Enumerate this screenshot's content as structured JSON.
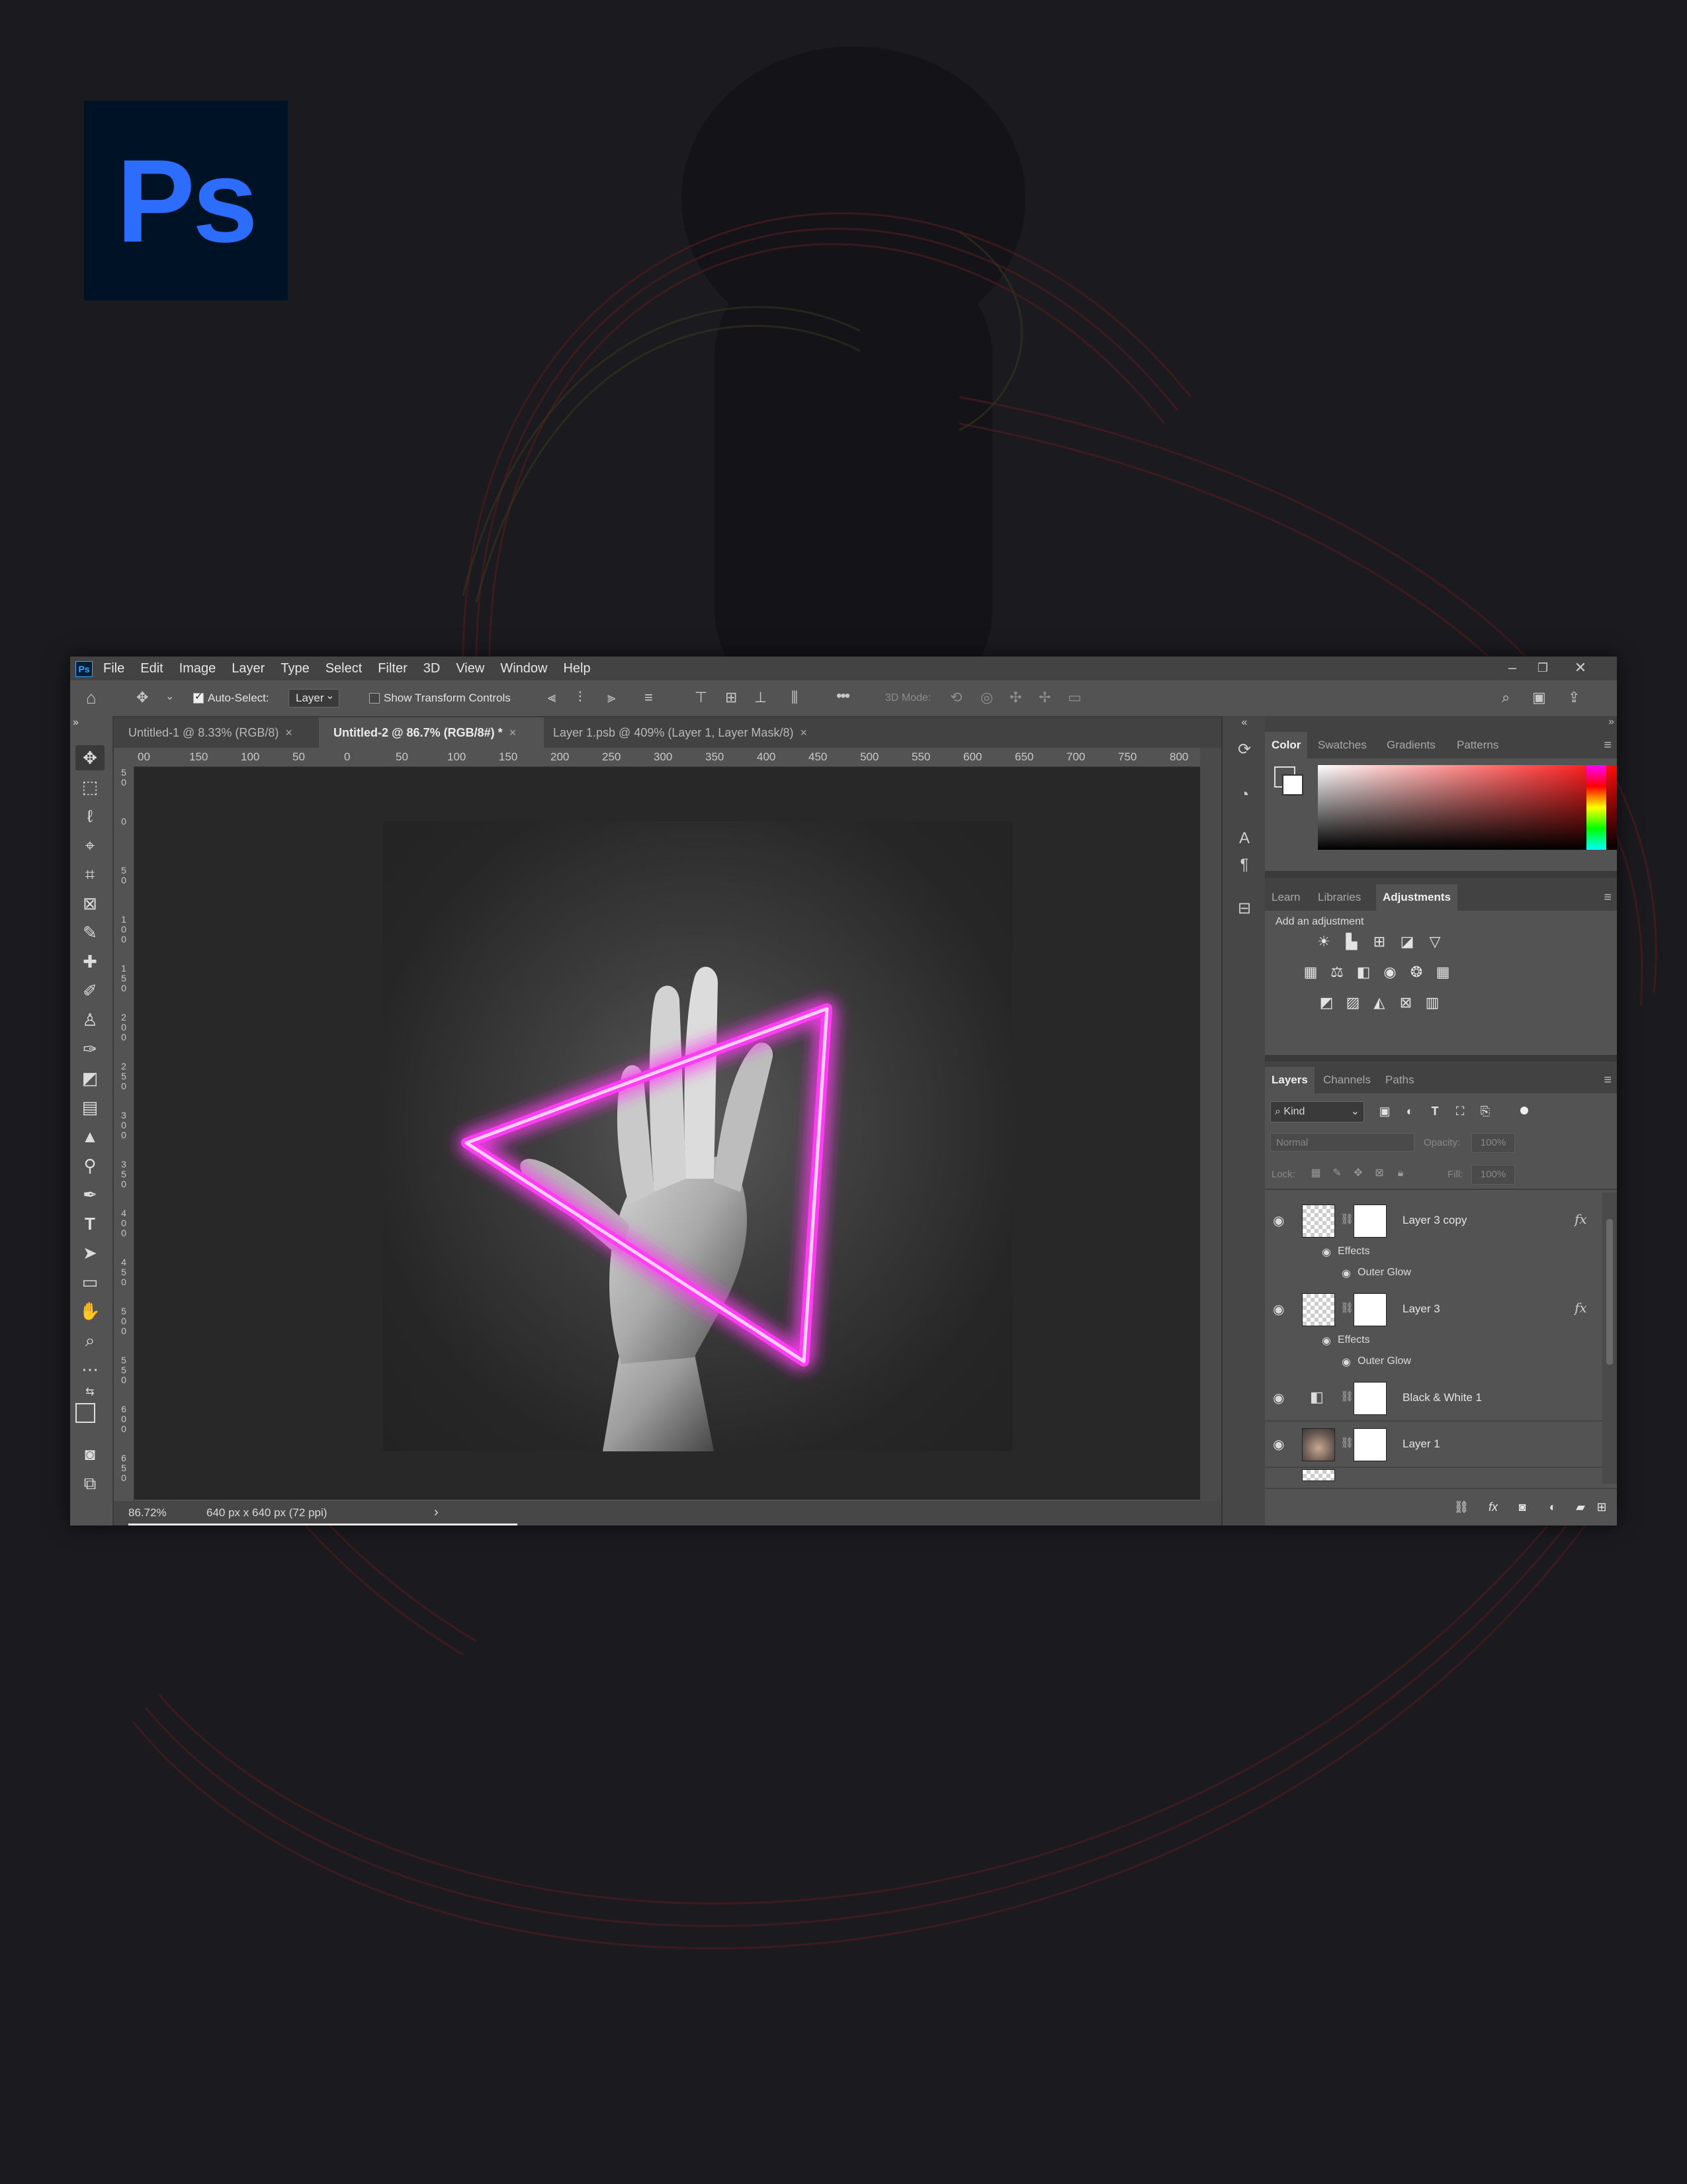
{
  "logo": {
    "text": "Ps"
  },
  "window": {
    "app_icon": "Ps",
    "menu": [
      "File",
      "Edit",
      "Image",
      "Layer",
      "Type",
      "Select",
      "Filter",
      "3D",
      "View",
      "Window",
      "Help"
    ],
    "controls": {
      "minimize": "–",
      "restore": "❐",
      "close": "✕"
    }
  },
  "options_bar": {
    "auto_select_label": "Auto-Select:",
    "auto_select_checked": true,
    "target_dropdown": "Layer",
    "show_transform_label": "Show Transform Controls",
    "show_transform_checked": false,
    "three_d_mode_label": "3D Mode:",
    "more": "•••"
  },
  "doc_tabs": [
    {
      "label": "Untitled-1 @ 8.33% (RGB/8)",
      "active": false
    },
    {
      "label": "Untitled-2 @ 86.7% (RGB/8#) *",
      "active": true
    },
    {
      "label": "Layer 1.psb @ 409% (Layer 1, Layer Mask/8)",
      "active": false
    }
  ],
  "close_glyph": "×",
  "ruler_top": [
    "00",
    "150",
    "100",
    "50",
    "0",
    "50",
    "100",
    "150",
    "200",
    "250",
    "300",
    "350",
    "400",
    "450",
    "500",
    "550",
    "600",
    "650",
    "700",
    "750",
    "800"
  ],
  "ruler_left": [
    "5 0",
    "0",
    "5 0",
    "1 0 0",
    "1 5 0",
    "2 0 0",
    "2 5 0",
    "3 0 0",
    "3 5 0",
    "4 0 0",
    "4 5 0",
    "5 0 0",
    "5 5 0",
    "6 0 0",
    "6 5 0"
  ],
  "status": {
    "zoom": "86.72%",
    "doc_info": "640 px x 640 px (72 ppi)",
    "arrow": "›"
  },
  "color_panel": {
    "tabs": [
      "Color",
      "Swatches",
      "Gradients",
      "Patterns"
    ],
    "active_tab": "Color",
    "hue_color": "#ff0000"
  },
  "adjustments_panel": {
    "tabs": [
      "Learn",
      "Libraries",
      "Adjustments"
    ],
    "active_tab": "Adjustments",
    "hint": "Add an adjustment",
    "icons_row1": [
      "brightness-icon",
      "levels-icon",
      "curves-icon",
      "exposure-icon",
      "vibrance-icon"
    ],
    "icons_row2": [
      "hue-sat-icon",
      "color-balance-icon",
      "black-white-icon",
      "photo-filter-icon",
      "channel-mixer-icon",
      "color-lookup-icon"
    ],
    "icons_row3": [
      "invert-icon",
      "posterize-icon",
      "threshold-icon",
      "selective-color-icon",
      "gradient-map-icon"
    ]
  },
  "layers_panel": {
    "tabs": [
      "Layers",
      "Channels",
      "Paths"
    ],
    "active_tab": "Layers",
    "filter_kind": "Kind",
    "blend_mode": "Normal",
    "opacity_label": "Opacity:",
    "opacity_value": "100%",
    "lock_label": "Lock:",
    "fill_label": "Fill:",
    "fill_value": "100%",
    "effects_label": "Effects",
    "outer_glow_label": "Outer Glow",
    "fx_label": "fx",
    "layers": [
      {
        "name": "Layer 3 copy",
        "has_fx": true
      },
      {
        "name": "Layer 3",
        "has_fx": true
      },
      {
        "name": "Black & White 1",
        "has_fx": false
      },
      {
        "name": "Layer 1",
        "has_fx": false
      }
    ]
  },
  "colors": {
    "neon": "#ff3df2",
    "accent_blue": "#2c6dfd",
    "panel": "#535353"
  }
}
